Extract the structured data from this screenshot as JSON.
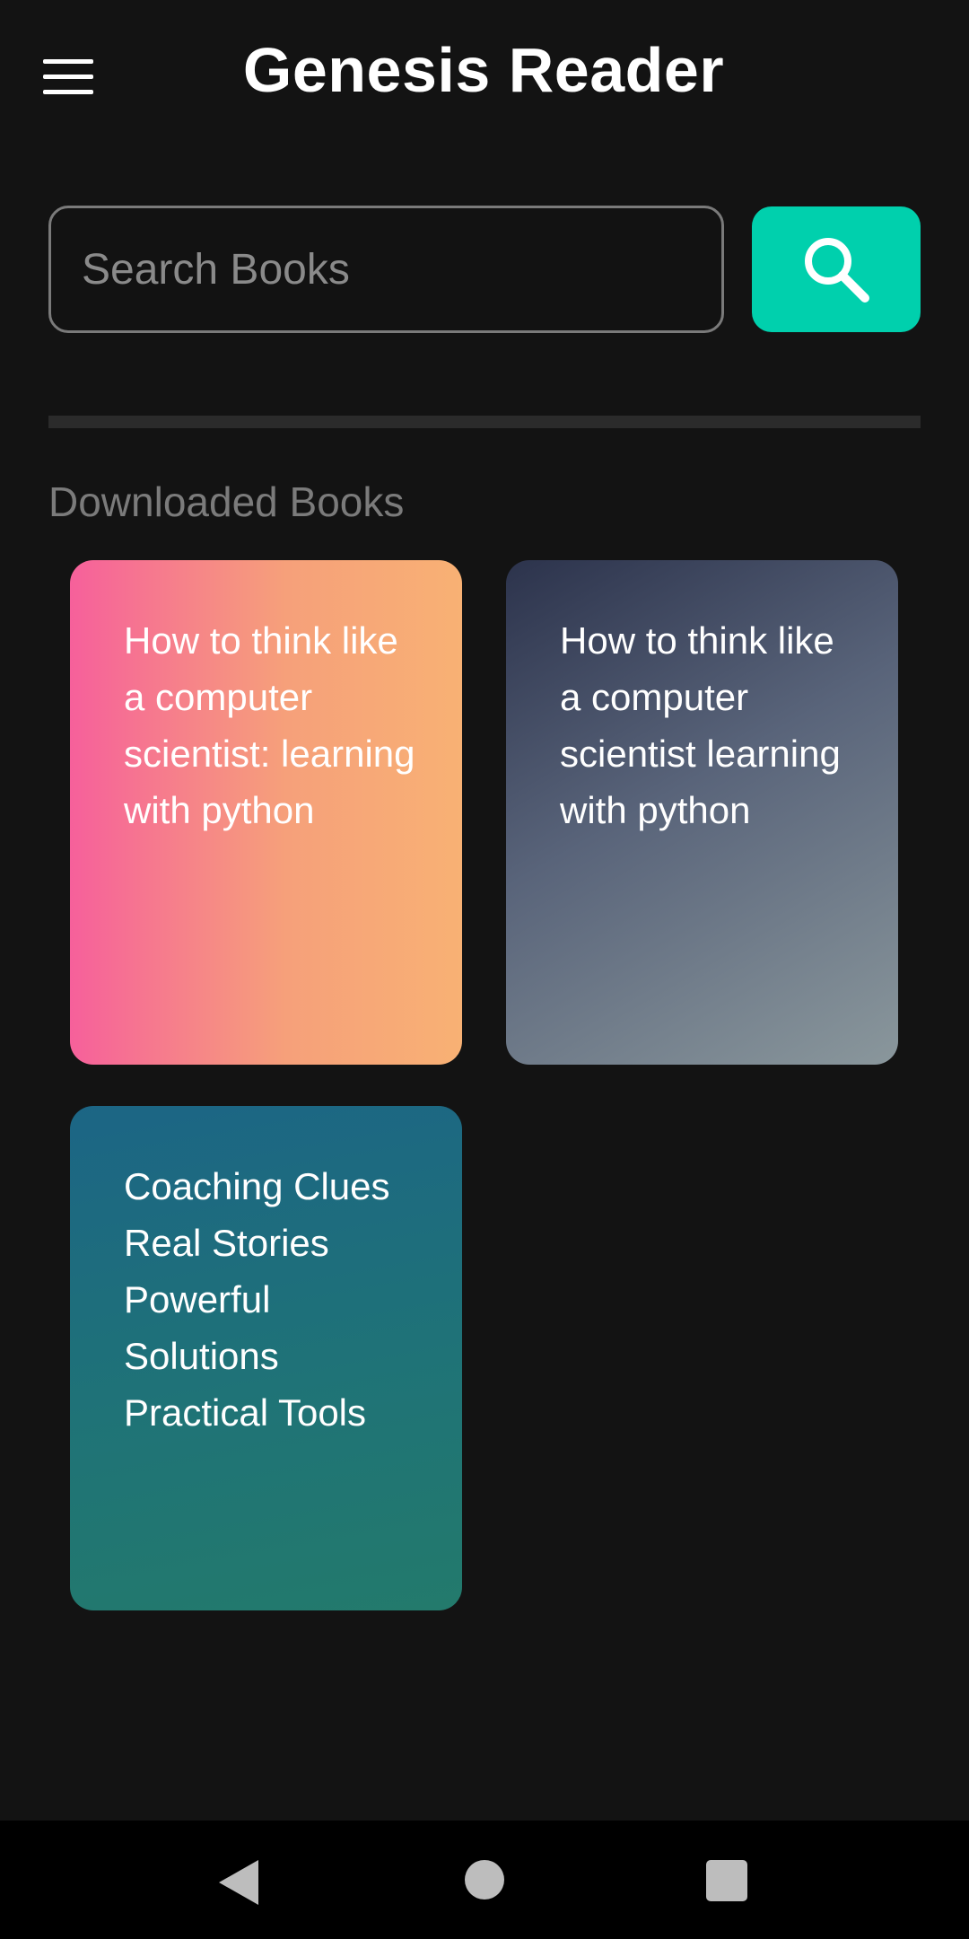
{
  "app": {
    "title": "Genesis Reader"
  },
  "search": {
    "placeholder": "Search Books",
    "value": "",
    "button_icon": "search-icon"
  },
  "downloaded": {
    "label": "Downloaded Books",
    "books": [
      {
        "title": "How to think like a computer scientist: learning with python"
      },
      {
        "title": "How to think like a computer scientist learning with python"
      },
      {
        "title": "Coaching Clues Real Stories Powerful Solutions Practical Tools"
      }
    ]
  },
  "colors": {
    "background": "#131313",
    "accent": "#00d0ad"
  },
  "navbar": {
    "icons": [
      "back-icon",
      "home-icon",
      "recents-icon"
    ]
  }
}
